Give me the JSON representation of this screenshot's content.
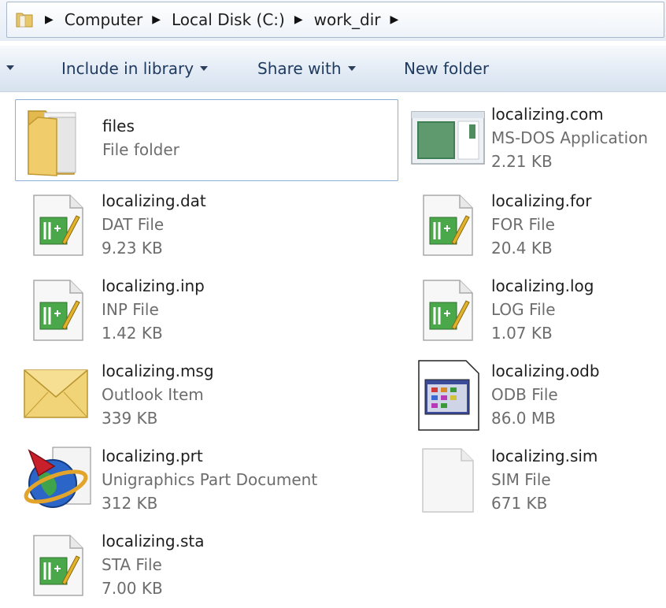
{
  "address_bar": {
    "crumbs": [
      "Computer",
      "Local Disk (C:)",
      "work_dir"
    ]
  },
  "toolbar": {
    "include_in_library": "Include in library",
    "share_with": "Share with",
    "new_folder": "New folder"
  },
  "items": [
    {
      "name": "files",
      "type": "File folder",
      "size": "",
      "icon": "folder-icon"
    },
    {
      "name": "localizing.com",
      "type": "MS-DOS Application",
      "size": "2.21 KB",
      "icon": "application-window-icon"
    },
    {
      "name": "localizing.dat",
      "type": "DAT File",
      "size": "9.23 KB",
      "icon": "notepad-plus-file-icon"
    },
    {
      "name": "localizing.for",
      "type": "FOR File",
      "size": "20.4 KB",
      "icon": "notepad-plus-file-icon"
    },
    {
      "name": "localizing.inp",
      "type": "INP File",
      "size": "1.42 KB",
      "icon": "notepad-plus-file-icon"
    },
    {
      "name": "localizing.log",
      "type": "LOG File",
      "size": "1.07 KB",
      "icon": "notepad-plus-file-icon"
    },
    {
      "name": "localizing.msg",
      "type": "Outlook Item",
      "size": "339 KB",
      "icon": "envelope-icon"
    },
    {
      "name": "localizing.odb",
      "type": "ODB File",
      "size": "86.0 MB",
      "icon": "odb-window-icon"
    },
    {
      "name": "localizing.prt",
      "type": "Unigraphics Part Document",
      "size": "312 KB",
      "icon": "unigraphics-globe-icon"
    },
    {
      "name": "localizing.sim",
      "type": "SIM File",
      "size": "671 KB",
      "icon": "blank-file-icon"
    },
    {
      "name": "localizing.sta",
      "type": "STA File",
      "size": "7.00 KB",
      "icon": "notepad-plus-file-icon"
    }
  ],
  "colors": {
    "selection_border": "#8aaed6",
    "secondary_text": "#6d6d6d",
    "toolbar_text": "#1e3a5f"
  }
}
